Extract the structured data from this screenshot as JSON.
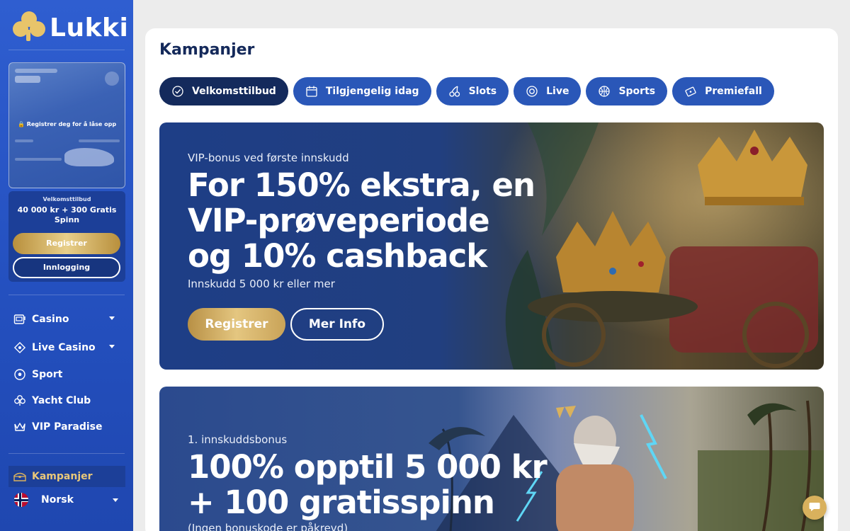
{
  "brand": {
    "name": "Lukki",
    "accent": "#2f5ed0",
    "gold": "#d9b15d"
  },
  "sidebar": {
    "welcome_card": {
      "lock_text": "Registrer deg for å låse opp"
    },
    "offer": {
      "label": "Velkomsttilbud",
      "amount": "40 000 kr + 300 Gratis Spinn",
      "register_label": "Registrer",
      "login_label": "Innlogging"
    },
    "nav": [
      {
        "label": "Casino",
        "icon": "slot-machine-icon",
        "has_dropdown": true
      },
      {
        "label": "Live Casino",
        "icon": "diamond-chip-icon",
        "has_dropdown": true
      },
      {
        "label": "Sport",
        "icon": "soccer-ball-icon",
        "has_dropdown": false
      },
      {
        "label": "Yacht Club",
        "icon": "clover-icon",
        "has_dropdown": false
      },
      {
        "label": "VIP Paradise",
        "icon": "crown-icon",
        "has_dropdown": false
      }
    ],
    "active_item": {
      "label": "Kampanjer",
      "icon": "treasure-chest-icon"
    },
    "language": {
      "label": "Norsk",
      "flag": "norway-flag-icon"
    }
  },
  "main": {
    "title": "Kampanjer",
    "tabs": [
      {
        "label": "Velkomsttilbud",
        "icon": "check-circle-icon",
        "active": true
      },
      {
        "label": "Tilgjengelig idag",
        "icon": "calendar-icon",
        "active": false
      },
      {
        "label": "Slots",
        "icon": "cherries-icon",
        "active": false
      },
      {
        "label": "Live",
        "icon": "chip-icon",
        "active": false
      },
      {
        "label": "Sports",
        "icon": "basketball-icon",
        "active": false
      },
      {
        "label": "Premiefall",
        "icon": "ticket-icon",
        "active": false
      }
    ],
    "banners": [
      {
        "eyebrow": "VIP-bonus ved første innskudd",
        "headline_lines": [
          "For 150% ekstra, en",
          "VIP-prøveperiode",
          "og 10% cashback"
        ],
        "sub": "Innskudd 5 000 kr eller mer",
        "primary_label": "Registrer",
        "secondary_label": "Mer Info"
      },
      {
        "eyebrow": "1. innskuddsbonus",
        "headline_lines": [
          "100% opptil 5 000 kr",
          "+ 100 gratisspinn"
        ],
        "sub": "(Ingen bonuskode er påkrevd)"
      }
    ]
  }
}
